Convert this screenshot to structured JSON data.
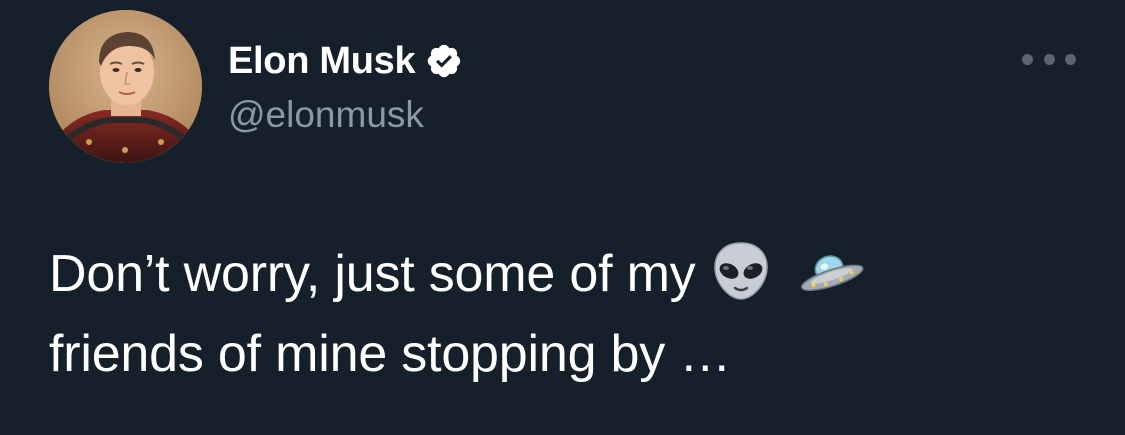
{
  "author": {
    "display_name": "Elon Musk",
    "handle": "@elonmusk",
    "verified": true,
    "avatar_icon": "profile-photo"
  },
  "tweet": {
    "line1_text": "Don’t worry, just some of my",
    "line1_emojis": [
      "alien-emoji",
      "ufo-emoji"
    ],
    "line2_text": "friends of mine stopping by …"
  },
  "controls": {
    "more_icon": "more-horizontal-icon"
  },
  "colors": {
    "background": "#15202b",
    "primary_text": "#ffffff",
    "secondary_text": "#8b98a5",
    "icon_muted": "#5b6670"
  }
}
